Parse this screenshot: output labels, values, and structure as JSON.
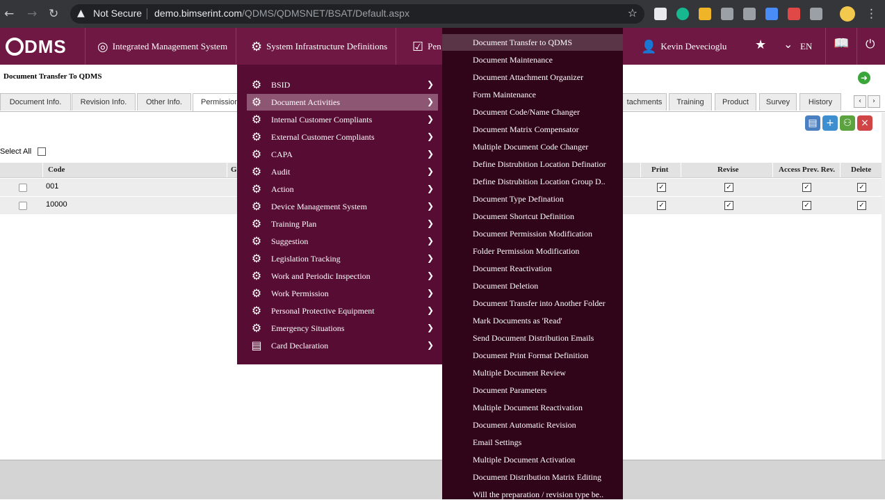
{
  "browser": {
    "back": "←",
    "forward": "→",
    "reload": "↻",
    "warning_icon": "▲",
    "security_text": "Not Secure",
    "url_host": "demo.bimserint.com",
    "url_path": "/QDMS/QDMSNET/BSAT/Default.aspx",
    "star": "☆",
    "menu": "⋮"
  },
  "app": {
    "logo": "DMS",
    "nav": [
      {
        "label": "Integrated Management System",
        "icon": "◎"
      },
      {
        "label": "System Infrastructure Definitions",
        "icon": "⚙"
      },
      {
        "label": "Pen",
        "icon": "☑"
      }
    ],
    "user": {
      "name": "Kevin Devecioglu",
      "icon": "👤"
    },
    "favorites_icon": "★",
    "chevron": "⌄",
    "language": "EN",
    "book_icon": "📖",
    "power_icon": "⏻"
  },
  "page": {
    "title": "Document Transfer To QDMS",
    "back_icon": "➜",
    "tabs": [
      "Document Info.",
      "Revision Info.",
      "Other Info.",
      "Permission",
      "tachments",
      "Training",
      "Product",
      "Survey",
      "History"
    ],
    "active_tab": "Permission",
    "tab_prev": "‹",
    "tab_next": "›",
    "select_all": "Select All",
    "columns": {
      "code": "Code",
      "g": "G",
      "print": "Print",
      "revise": "Revise",
      "access_prev_rev": "Access Prev. Rev.",
      "delete": "Delete"
    },
    "rows": [
      {
        "code": "001"
      },
      {
        "code": "10000"
      }
    ],
    "check_mark": "✓"
  },
  "menu": {
    "arrow": "❯",
    "left_items": [
      {
        "label": "BSID",
        "icon": "⚙"
      },
      {
        "label": "Document Activities",
        "icon": "⚙"
      },
      {
        "label": "Internal Customer Compliants",
        "icon": "⚙"
      },
      {
        "label": "External Customer Compliants",
        "icon": "⚙"
      },
      {
        "label": "CAPA",
        "icon": "⚙"
      },
      {
        "label": "Audit",
        "icon": "⚙"
      },
      {
        "label": "Action",
        "icon": "⚙"
      },
      {
        "label": "Device Management System",
        "icon": "⚙"
      },
      {
        "label": "Training Plan",
        "icon": "⚙"
      },
      {
        "label": "Suggestion",
        "icon": "⚙"
      },
      {
        "label": "Legislation Tracking",
        "icon": "⚙"
      },
      {
        "label": "Work and Periodic Inspection",
        "icon": "⚙"
      },
      {
        "label": "Work Permission",
        "icon": "⚙"
      },
      {
        "label": "Personal Protective Equipment",
        "icon": "⚙"
      },
      {
        "label": "Emergency Situations",
        "icon": "⚙"
      },
      {
        "label": "Card Declaration",
        "icon": "▤"
      }
    ],
    "selected_left": "Document Activities",
    "right_items": [
      "Document Transfer to QDMS",
      "Document Maintenance",
      "Document Attachment Organizer",
      "Form Maintenance",
      "Document Code/Name Changer",
      "Document Matrix Compensator",
      "Multiple Document Code Changer",
      "Define Distrubition Location Definatior",
      "Define Distrubition Location Group D..",
      "Document Type Defination",
      "Document Shortcut Definition",
      "Document Permission Modification",
      "Folder Permission Modification",
      "Document Reactivation",
      "Document Deletion",
      "Document Transfer into Another Folder",
      "Mark Documents as 'Read'",
      "Send Document Distribution Emails",
      "Document Print Format Definition",
      "Multiple Document Review",
      "Document Parameters",
      "Multiple Document Reactivation",
      "Document Automatic Revision",
      "Email Settings",
      "Multiple Document Activation",
      "Document Distribution Matrix Editing",
      "Will the preparation / revision type be.."
    ],
    "selected_right": "Document Transfer to QDMS"
  }
}
